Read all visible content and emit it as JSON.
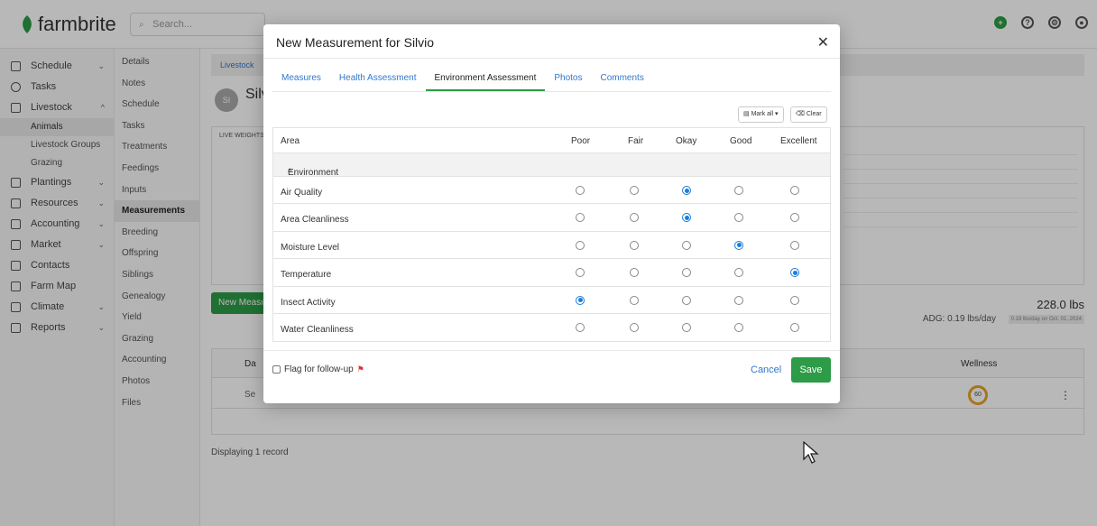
{
  "app": {
    "logo": "farmbrite",
    "search_placeholder": "Search..."
  },
  "nav": {
    "items": [
      {
        "label": "Schedule",
        "icon": "calendar-icon",
        "chevron": true
      },
      {
        "label": "Tasks",
        "icon": "check-circle-icon",
        "chevron": false
      },
      {
        "label": "Livestock",
        "icon": "cow-icon",
        "chevron": true,
        "expanded": true
      },
      {
        "label": "Plantings",
        "icon": "sprout-icon",
        "chevron": true
      },
      {
        "label": "Resources",
        "icon": "resources-icon",
        "chevron": true
      },
      {
        "label": "Accounting",
        "icon": "calculator-icon",
        "chevron": true
      },
      {
        "label": "Market",
        "icon": "store-icon",
        "chevron": true
      },
      {
        "label": "Contacts",
        "icon": "contact-icon",
        "chevron": false
      },
      {
        "label": "Farm Map",
        "icon": "map-icon",
        "chevron": false
      },
      {
        "label": "Climate",
        "icon": "cloud-icon",
        "chevron": true
      },
      {
        "label": "Reports",
        "icon": "report-icon",
        "chevron": true
      }
    ],
    "livestock_sub": [
      "Animals",
      "Livestock Groups",
      "Grazing"
    ]
  },
  "subnav": [
    "Details",
    "Notes",
    "Schedule",
    "Tasks",
    "Treatments",
    "Feedings",
    "Inputs",
    "Measurements",
    "Breeding",
    "Offspring",
    "Siblings",
    "Genealogy",
    "Yield",
    "Grazing",
    "Accounting",
    "Photos",
    "Files"
  ],
  "page": {
    "breadcrumb": "Livestock",
    "avatar": "SI",
    "animal_name": "Silv",
    "chart_title": "LIVE WEIGHTS",
    "new_button": "New Meası",
    "weight": "228.0 lbs",
    "adg": "ADG: 0.19 lbs/day",
    "adg_note": "0.19 lbs/day on Oct. 01, 2024",
    "table_col_date": "Da",
    "table_col_wellness": "Wellness",
    "table_row_date": "Se",
    "wellness_score": "60",
    "footer": "Displaying 1 record"
  },
  "modal": {
    "title": "New Measurement for Silvio",
    "tabs": [
      "Measures",
      "Health Assessment",
      "Environment Assessment",
      "Photos",
      "Comments"
    ],
    "active_tab": "Environment Assessment",
    "mark_all": "Mark all",
    "clear": "Clear",
    "columns": [
      "Area",
      "Poor",
      "Fair",
      "Okay",
      "Good",
      "Excellent"
    ],
    "section": "Environment",
    "rows": [
      {
        "label": "Air Quality",
        "selected": 2
      },
      {
        "label": "Area Cleanliness",
        "selected": 2
      },
      {
        "label": "Moisture Level",
        "selected": 3
      },
      {
        "label": "Temperature",
        "selected": 4
      },
      {
        "label": "Insect Activity",
        "selected": 0
      },
      {
        "label": "Water Cleanliness",
        "selected": -1
      }
    ],
    "flag_label": "Flag for follow-up",
    "cancel": "Cancel",
    "save": "Save"
  },
  "colors": {
    "accent_green": "#2d9b47",
    "link_blue": "#3377cc",
    "radio_blue": "#1a7de0"
  }
}
